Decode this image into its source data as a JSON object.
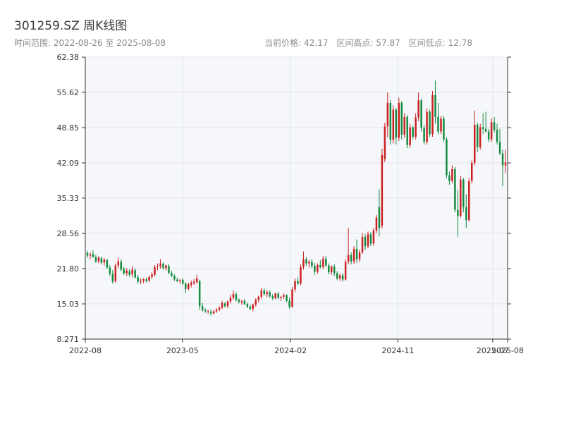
{
  "header": {
    "title": "301259.SZ 周K线图",
    "range_label": "时间范围:",
    "range_start": "2022-08-26",
    "range_sep": "至",
    "range_end": "2025-08-08",
    "current_price_label": "当前价格:",
    "current_price": "42.17",
    "high_label": "区间高点:",
    "high": "57.87",
    "low_label": "区间低点:",
    "low": "12.78"
  },
  "colors": {
    "up": "#cc1f1f",
    "down": "#138a3e",
    "plot_bg": "#f5f7fa",
    "grid": "#e3e6ea",
    "axis": "#333333"
  },
  "chart_data": {
    "type": "candlestick",
    "title": "",
    "ylim": [
      8.271,
      62.38
    ],
    "y_ticks": [
      "8.271",
      "15.03",
      "21.80",
      "28.56",
      "35.33",
      "42.09",
      "48.85",
      "55.62",
      "62.38"
    ],
    "x_start": "2022-08-26",
    "x_end": "2025-08-08",
    "x_ticks": [
      {
        "date": "2022-08-01",
        "label": "2022-08"
      },
      {
        "date": "2023-05-01",
        "label": "2023-05"
      },
      {
        "date": "2024-02-01",
        "label": "2024-02"
      },
      {
        "date": "2024-11-01",
        "label": "2024-11"
      },
      {
        "date": "2025-07-01",
        "label": "2025-07"
      },
      {
        "date": "2025-08-08",
        "label": "2025-08"
      }
    ],
    "grid": true,
    "ohlc_note_fields": [
      "open",
      "high",
      "low",
      "close"
    ],
    "candles": [
      [
        24.8,
        25.2,
        23.9,
        24.3
      ],
      [
        24.3,
        24.9,
        23.6,
        24.5
      ],
      [
        24.6,
        25.3,
        23.9,
        24.0
      ],
      [
        24.0,
        24.4,
        22.9,
        23.2
      ],
      [
        23.2,
        24.2,
        22.8,
        23.9
      ],
      [
        23.8,
        24.1,
        22.6,
        22.9
      ],
      [
        23.0,
        23.8,
        22.4,
        23.5
      ],
      [
        23.4,
        23.7,
        21.8,
        22.0
      ],
      [
        22.0,
        22.5,
        20.4,
        20.8
      ],
      [
        20.8,
        21.5,
        18.9,
        19.3
      ],
      [
        19.4,
        22.8,
        19.1,
        22.4
      ],
      [
        22.4,
        23.9,
        21.9,
        23.2
      ],
      [
        23.1,
        23.6,
        21.3,
        21.6
      ],
      [
        21.7,
        22.1,
        20.6,
        20.9
      ],
      [
        20.9,
        21.9,
        20.4,
        21.4
      ],
      [
        21.3,
        21.7,
        20.2,
        20.6
      ],
      [
        20.7,
        22.3,
        20.1,
        21.6
      ],
      [
        21.5,
        21.9,
        19.9,
        20.1
      ],
      [
        20.1,
        20.6,
        18.9,
        19.3
      ],
      [
        19.3,
        19.9,
        18.8,
        19.4
      ],
      [
        19.5,
        19.9,
        19.0,
        19.8
      ],
      [
        19.7,
        20.1,
        19.1,
        19.4
      ],
      [
        19.5,
        20.5,
        19.2,
        20.2
      ],
      [
        20.2,
        21.1,
        19.8,
        20.7
      ],
      [
        20.6,
        22.5,
        20.3,
        22.1
      ],
      [
        22.1,
        22.8,
        21.5,
        22.3
      ],
      [
        22.3,
        23.6,
        21.8,
        22.8
      ],
      [
        22.7,
        23.0,
        21.6,
        21.9
      ],
      [
        21.9,
        22.6,
        21.4,
        22.4
      ],
      [
        22.3,
        22.7,
        20.7,
        21.0
      ],
      [
        21.0,
        21.4,
        20.2,
        20.4
      ],
      [
        20.4,
        20.7,
        19.4,
        19.7
      ],
      [
        19.7,
        20.1,
        19.2,
        19.4
      ],
      [
        19.4,
        19.8,
        18.9,
        19.6
      ],
      [
        19.6,
        20.0,
        18.7,
        18.9
      ],
      [
        18.9,
        19.2,
        17.1,
        17.9
      ],
      [
        17.9,
        19.1,
        17.6,
        18.8
      ],
      [
        18.7,
        19.5,
        18.2,
        19.1
      ],
      [
        19.0,
        19.8,
        18.7,
        19.3
      ],
      [
        19.2,
        20.6,
        18.9,
        19.9
      ],
      [
        19.4,
        19.7,
        13.9,
        14.6
      ],
      [
        14.6,
        15.2,
        13.6,
        13.8
      ],
      [
        13.8,
        14.2,
        13.3,
        13.6
      ],
      [
        13.6,
        13.9,
        13.1,
        13.7
      ],
      [
        13.5,
        14.0,
        12.78,
        13.2
      ],
      [
        13.2,
        13.8,
        13.0,
        13.6
      ],
      [
        13.6,
        14.2,
        13.3,
        13.9
      ],
      [
        13.9,
        14.6,
        13.6,
        14.3
      ],
      [
        14.3,
        15.6,
        14.0,
        15.2
      ],
      [
        15.1,
        15.4,
        14.3,
        14.6
      ],
      [
        14.6,
        15.7,
        14.2,
        15.5
      ],
      [
        15.5,
        16.8,
        15.1,
        16.2
      ],
      [
        16.2,
        17.6,
        15.8,
        16.9
      ],
      [
        16.9,
        17.3,
        15.5,
        15.8
      ],
      [
        15.8,
        16.1,
        15.1,
        15.4
      ],
      [
        15.4,
        15.8,
        14.9,
        15.6
      ],
      [
        15.6,
        16.0,
        14.8,
        15.0
      ],
      [
        15.0,
        15.3,
        14.2,
        14.5
      ],
      [
        14.5,
        14.9,
        13.8,
        14.1
      ],
      [
        14.1,
        15.1,
        13.6,
        14.9
      ],
      [
        14.9,
        16.1,
        14.5,
        15.8
      ],
      [
        15.8,
        16.6,
        15.3,
        16.4
      ],
      [
        16.4,
        18.1,
        16.0,
        17.6
      ],
      [
        17.6,
        18.0,
        16.6,
        16.9
      ],
      [
        16.9,
        17.7,
        16.3,
        17.3
      ],
      [
        17.3,
        17.6,
        16.2,
        16.5
      ],
      [
        16.5,
        16.9,
        15.8,
        16.1
      ],
      [
        16.1,
        17.2,
        15.9,
        17.0
      ],
      [
        17.0,
        17.3,
        15.9,
        16.2
      ],
      [
        16.2,
        16.6,
        15.6,
        16.4
      ],
      [
        16.4,
        17.1,
        16.0,
        16.7
      ],
      [
        16.7,
        16.9,
        15.3,
        15.6
      ],
      [
        15.6,
        16.2,
        14.1,
        14.5
      ],
      [
        14.5,
        18.3,
        14.3,
        17.8
      ],
      [
        17.8,
        19.9,
        17.3,
        19.4
      ],
      [
        19.4,
        20.1,
        18.6,
        18.9
      ],
      [
        18.9,
        22.6,
        18.6,
        22.1
      ],
      [
        22.1,
        25.1,
        21.6,
        23.6
      ],
      [
        23.6,
        24.0,
        22.3,
        22.8
      ],
      [
        22.8,
        23.5,
        22.0,
        23.1
      ],
      [
        23.1,
        23.6,
        21.9,
        22.3
      ],
      [
        22.3,
        22.9,
        20.6,
        21.2
      ],
      [
        21.2,
        22.8,
        20.8,
        22.5
      ],
      [
        22.5,
        23.4,
        21.8,
        22.1
      ],
      [
        22.1,
        24.2,
        21.7,
        23.7
      ],
      [
        23.7,
        24.2,
        22.1,
        22.4
      ],
      [
        22.4,
        22.8,
        20.7,
        21.1
      ],
      [
        21.1,
        22.4,
        20.6,
        22.2
      ],
      [
        22.2,
        22.6,
        20.4,
        20.9
      ],
      [
        20.9,
        21.3,
        19.6,
        19.9
      ],
      [
        19.9,
        20.8,
        19.4,
        20.5
      ],
      [
        20.5,
        20.9,
        19.3,
        19.7
      ],
      [
        19.7,
        23.6,
        19.5,
        23.1
      ],
      [
        23.1,
        29.6,
        22.6,
        24.4
      ],
      [
        24.4,
        24.9,
        22.6,
        23.2
      ],
      [
        23.2,
        26.1,
        22.7,
        25.6
      ],
      [
        25.6,
        27.4,
        22.9,
        23.6
      ],
      [
        23.6,
        25.4,
        23.1,
        24.9
      ],
      [
        24.9,
        28.6,
        24.6,
        27.9
      ],
      [
        27.9,
        28.4,
        25.4,
        26.1
      ],
      [
        26.1,
        28.9,
        25.7,
        28.4
      ],
      [
        28.4,
        28.8,
        26.1,
        26.6
      ],
      [
        26.6,
        29.6,
        26.2,
        29.1
      ],
      [
        29.1,
        32.1,
        28.6,
        31.6
      ],
      [
        33.6,
        37.0,
        28.0,
        29.6
      ],
      [
        30.0,
        44.8,
        29.5,
        43.6
      ],
      [
        42.8,
        49.8,
        42.2,
        49.1
      ],
      [
        49.1,
        55.6,
        47.0,
        53.6
      ],
      [
        53.6,
        54.1,
        45.6,
        46.5
      ],
      [
        46.5,
        53.1,
        45.8,
        52.3
      ],
      [
        52.3,
        52.6,
        45.6,
        46.9
      ],
      [
        46.9,
        54.6,
        46.3,
        53.6
      ],
      [
        53.6,
        54.0,
        46.6,
        47.5
      ],
      [
        47.5,
        51.6,
        46.9,
        50.9
      ],
      [
        50.9,
        51.3,
        44.9,
        45.5
      ],
      [
        45.5,
        49.6,
        45.0,
        48.9
      ],
      [
        48.9,
        49.2,
        46.6,
        47.1
      ],
      [
        47.1,
        51.6,
        46.6,
        50.8
      ],
      [
        50.8,
        55.6,
        50.1,
        54.1
      ],
      [
        54.1,
        54.4,
        48.1,
        48.8
      ],
      [
        48.8,
        49.3,
        45.6,
        46.1
      ],
      [
        46.1,
        52.6,
        45.6,
        51.9
      ],
      [
        51.9,
        52.3,
        47.1,
        47.6
      ],
      [
        47.6,
        55.9,
        47.1,
        55.1
      ],
      [
        55.1,
        57.87,
        49.6,
        50.9
      ],
      [
        50.9,
        53.6,
        47.6,
        48.1
      ],
      [
        48.1,
        51.1,
        47.6,
        50.6
      ],
      [
        50.6,
        51.1,
        46.1,
        46.6
      ],
      [
        46.6,
        47.0,
        39.1,
        39.7
      ],
      [
        39.7,
        40.4,
        37.9,
        38.6
      ],
      [
        38.6,
        41.6,
        38.2,
        40.9
      ],
      [
        40.9,
        41.3,
        32.6,
        33.1
      ],
      [
        33.1,
        36.9,
        27.9,
        31.9
      ],
      [
        31.9,
        39.6,
        31.6,
        38.9
      ],
      [
        38.9,
        39.2,
        32.6,
        33.6
      ],
      [
        33.6,
        36.1,
        29.6,
        31.1
      ],
      [
        31.1,
        39.2,
        30.8,
        38.6
      ],
      [
        38.6,
        42.6,
        38.1,
        42.1
      ],
      [
        42.1,
        52.1,
        41.6,
        49.4
      ],
      [
        49.4,
        49.8,
        44.1,
        45.1
      ],
      [
        45.1,
        49.6,
        44.6,
        48.9
      ],
      [
        48.9,
        51.6,
        47.6,
        48.6
      ],
      [
        48.6,
        51.9,
        47.9,
        48.1
      ],
      [
        48.1,
        48.6,
        46.1,
        46.6
      ],
      [
        46.6,
        50.6,
        46.1,
        49.9
      ],
      [
        49.9,
        50.9,
        47.9,
        48.4
      ],
      [
        48.4,
        49.6,
        45.6,
        46.1
      ],
      [
        46.1,
        48.6,
        43.6,
        43.9
      ],
      [
        43.9,
        44.6,
        37.6,
        41.6
      ],
      [
        41.6,
        44.6,
        40.1,
        42.17
      ]
    ]
  }
}
